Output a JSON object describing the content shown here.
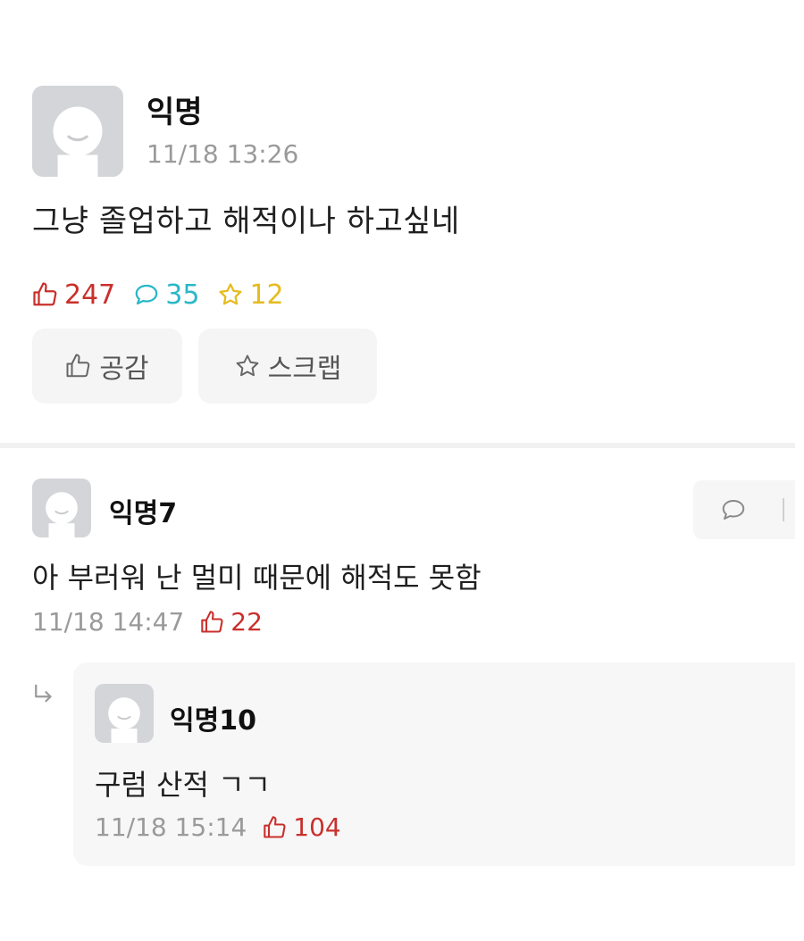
{
  "post": {
    "author": "익명",
    "time": "11/18 13:26",
    "body": "그냥 졸업하고 해적이나 하고싶네",
    "stats": {
      "likes": "247",
      "comments": "35",
      "scraps": "12"
    },
    "buttons": {
      "empathy": "공감",
      "scrap": "스크랩"
    }
  },
  "comments": [
    {
      "author": "익명7",
      "body": "아 부러워 난 멀미 때문에 해적도 못함",
      "time": "11/18 14:47",
      "likes": "22"
    }
  ],
  "reply": {
    "author": "익명10",
    "body": "구럼 산적 ㄱㄱ",
    "time": "11/18 15:14",
    "likes": "104"
  },
  "colors": {
    "like": "#c9302c",
    "comment": "#2ab7c9",
    "scrap": "#e6bb1e",
    "muted": "#9a9a9a"
  }
}
